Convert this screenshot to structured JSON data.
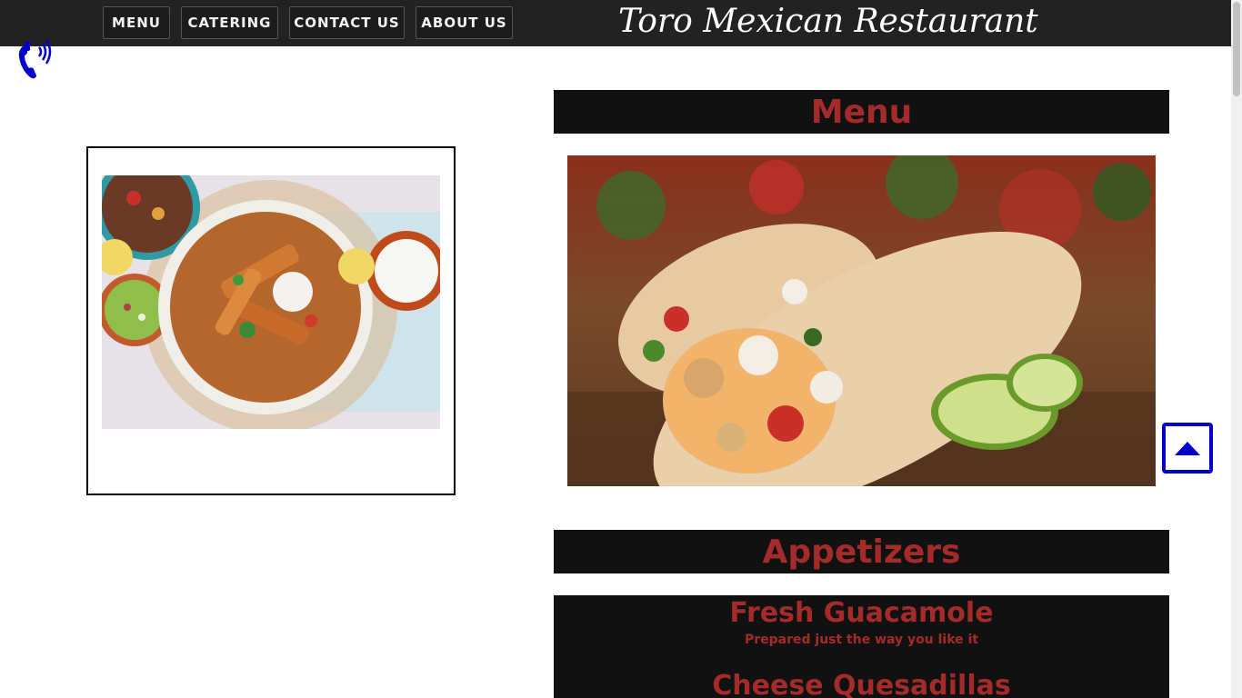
{
  "nav": {
    "menu_label": "MENU",
    "catering_label": "CATERING",
    "contact_label": "CONTACT US",
    "about_label": "ABOUT US"
  },
  "brand": {
    "title": "Toro Mexican Restaurant"
  },
  "sections": {
    "menu_title": "Menu",
    "appetizers_title": "Appetizers"
  },
  "items": [
    {
      "name": "Fresh Guacamole",
      "description": "Prepared just the way you like it"
    },
    {
      "name": "Cheese Quesadillas"
    }
  ],
  "colors": {
    "navbar_bg": "#222222",
    "header_bg": "#111111",
    "accent_red": "#a52a2a",
    "icon_blue": "#0000cc"
  },
  "icons": {
    "phone": "phone-ringing-icon",
    "back_to_top": "caret-up-icon"
  }
}
